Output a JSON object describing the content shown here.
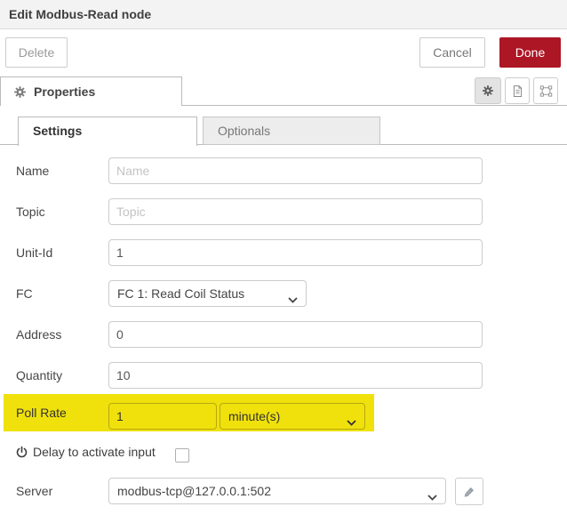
{
  "colors": {
    "accent_red": "#AD1625",
    "highlight_yellow": "#F0E10C",
    "header_bg": "#f3f3f3"
  },
  "header": {
    "title": "Edit Modbus-Read node"
  },
  "toolbar": {
    "delete_label": "Delete",
    "cancel_label": "Cancel",
    "done_label": "Done"
  },
  "panel": {
    "properties_tab_label": "Properties"
  },
  "icons": {
    "gear": "gear cog glyph",
    "document": "sheet with text lines",
    "appearance": "selection frame with corner handles",
    "power": "power symbol",
    "pencil": "edit pencil",
    "chevron": "chevron-down"
  },
  "tabs": {
    "settings_label": "Settings",
    "optionals_label": "Optionals"
  },
  "form": {
    "name": {
      "label": "Name",
      "placeholder": "Name",
      "value": ""
    },
    "topic": {
      "label": "Topic",
      "placeholder": "Topic",
      "value": ""
    },
    "unit_id": {
      "label": "Unit-Id",
      "value": "1"
    },
    "fc": {
      "label": "FC",
      "value": "FC 1: Read Coil Status"
    },
    "address": {
      "label": "Address",
      "value": "0"
    },
    "quantity": {
      "label": "Quantity",
      "value": "10"
    },
    "poll_rate": {
      "label": "Poll Rate",
      "value": "1",
      "unit": "minute(s)",
      "highlighted": true
    },
    "delay": {
      "label": "Delay to activate input",
      "checked": false
    },
    "server": {
      "label": "Server",
      "value": "modbus-tcp@127.0.0.1:502"
    }
  }
}
